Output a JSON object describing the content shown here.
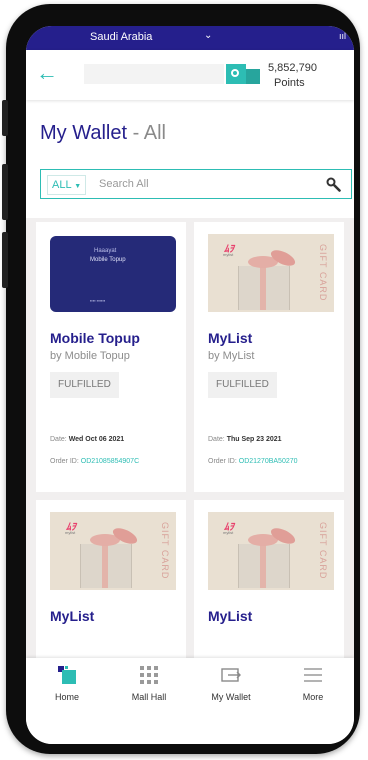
{
  "status_bar": {
    "country": "Saudi Arabia",
    "signal": "ııl"
  },
  "header": {
    "points_value": "5,852,790",
    "points_label": "Points"
  },
  "page": {
    "title": "My Wallet",
    "separator": "-",
    "subtitle": "All"
  },
  "search": {
    "filter_label": "ALL",
    "placeholder": "Search All"
  },
  "cards": [
    {
      "name": "Mobile Topup",
      "by": "by Mobile Topup",
      "status": "FULFILLED",
      "date_label": "Date:",
      "date": "Wed Oct 06 2021",
      "order_label": "Order ID:",
      "order_id": "OD21085854907C",
      "image": "mobile-topup-card",
      "image_text": {
        "brand": "Haaayat",
        "title": "Mobile Topup"
      }
    },
    {
      "name": "MyList",
      "by": "by MyList",
      "status": "FULFILLED",
      "date_label": "Date:",
      "date": "Thu Sep 23 2021",
      "order_label": "Order ID:",
      "order_id": "OD21270BA50270",
      "image": "gift-card",
      "image_text": {
        "logo": "ﾑｦ",
        "logo_sub": "mylist",
        "gift": "GIFT CARD"
      }
    },
    {
      "name": "MyList",
      "image": "gift-card",
      "image_text": {
        "logo": "ﾑｦ",
        "logo_sub": "mylist",
        "gift": "GIFT CARD"
      }
    },
    {
      "name": "MyList",
      "image": "gift-card",
      "image_text": {
        "logo": "ﾑｦ",
        "logo_sub": "mylist",
        "gift": "GIFT CARD"
      }
    }
  ],
  "bottom_nav": [
    {
      "label": "Home",
      "icon": "home-logo-icon"
    },
    {
      "label": "Mall Hall",
      "icon": "grid-icon"
    },
    {
      "label": "My Wallet",
      "icon": "wallet-icon"
    },
    {
      "label": "More",
      "icon": "hamburger-icon"
    }
  ],
  "colors": {
    "brand_navy": "#251f8c",
    "accent_teal": "#2dbdb4"
  }
}
